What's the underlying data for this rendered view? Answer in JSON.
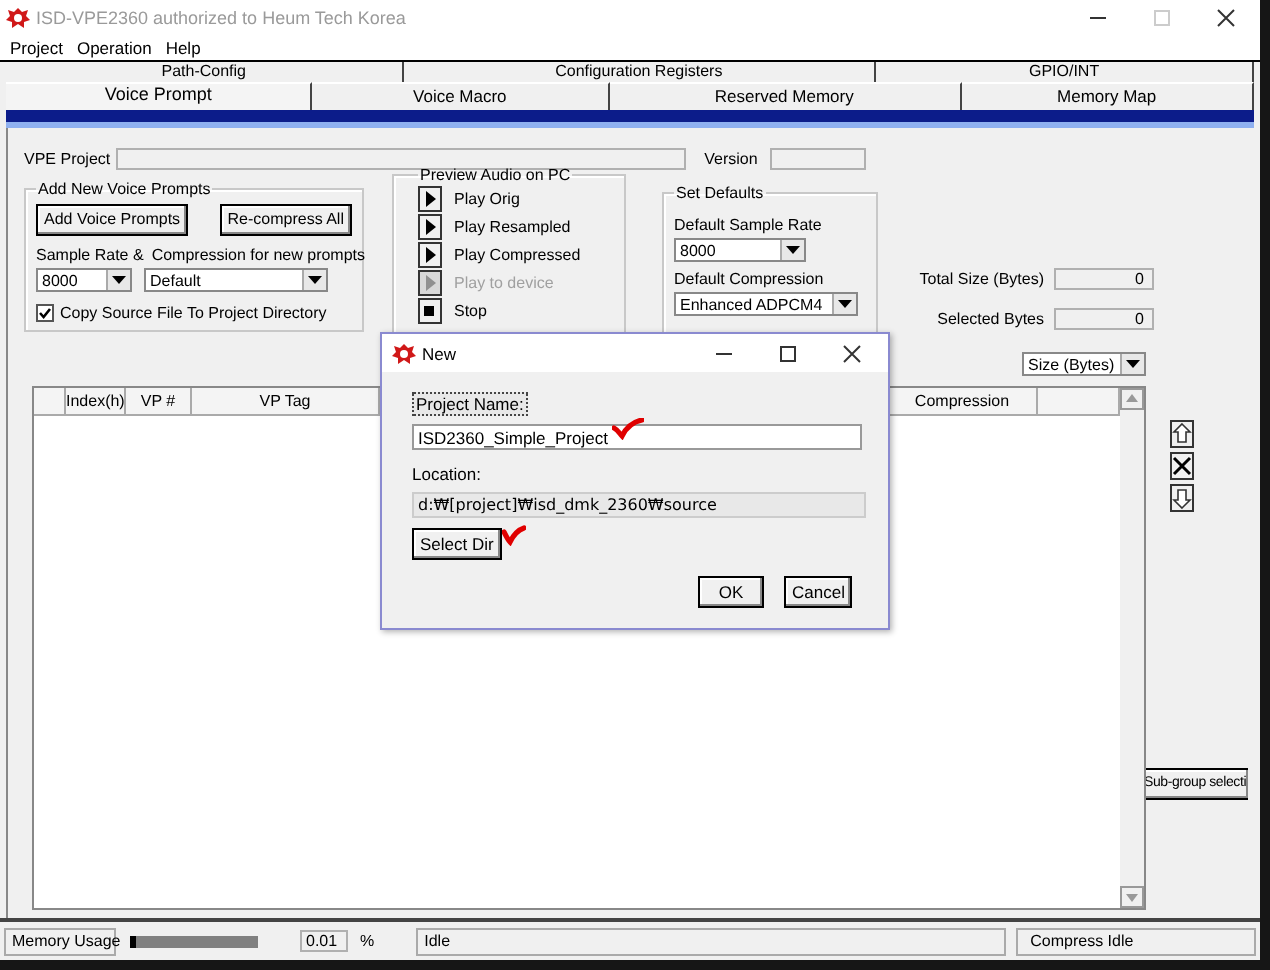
{
  "window": {
    "title": "ISD-VPE2360 authorized to Heum Tech Korea"
  },
  "menu": [
    "Project",
    "Operation",
    "Help"
  ],
  "back_tabs": [
    "Path-Config",
    "Configuration Registers",
    "GPIO/INT"
  ],
  "tabs": [
    {
      "label": "Voice Prompt",
      "selected": true
    },
    {
      "label": "Voice Macro",
      "selected": false
    },
    {
      "label": "Reserved Memory",
      "selected": false
    },
    {
      "label": "Memory Map",
      "selected": false
    }
  ],
  "project": {
    "label": "VPE Project",
    "version_label": "Version"
  },
  "add_group": {
    "title": "Add New Voice Prompts",
    "buttons": [
      "Add Voice Prompts",
      "Re-compress All"
    ],
    "sample_rate_label": "Sample Rate &",
    "sample_rate": "8000",
    "compression_label": "Compression for new prompts",
    "compression": "Default",
    "copy_source": {
      "label": "Copy Source File To Project Directory",
      "checked": true
    }
  },
  "preview": {
    "title": "Preview Audio on PC",
    "buttons": [
      {
        "label": "Play Orig",
        "kind": "play",
        "disabled": false
      },
      {
        "label": "Play Resampled",
        "kind": "play",
        "disabled": false
      },
      {
        "label": "Play Compressed",
        "kind": "play",
        "disabled": false
      },
      {
        "label": "Play to device",
        "kind": "play",
        "disabled": true
      },
      {
        "label": "Stop",
        "kind": "stop",
        "disabled": false
      }
    ]
  },
  "defaults": {
    "title": "Set Defaults",
    "sample_rate_label": "Default Sample Rate",
    "sample_rate": "8000",
    "compression_label": "Default Compression",
    "compression": "Enhanced ADPCM4"
  },
  "totals": [
    {
      "label": "Total Size (Bytes)",
      "value": "0"
    },
    {
      "label": "Selected Bytes",
      "value": "0"
    }
  ],
  "size_combo": "Size (Bytes)",
  "table": {
    "columns": [
      "Index(h)",
      "VP #",
      "VP Tag",
      "Compression"
    ]
  },
  "subgroup_button": "Sub-group selecti",
  "status_bar": {
    "memory_label": "Memory Usage",
    "memory": {
      "level": 0.04
    },
    "percent": "0.01",
    "percent_unit": "%",
    "status": "Idle",
    "compress_status": "Compress Idle"
  },
  "dialog": {
    "title": "New",
    "project_name_label": "Project Name:",
    "project_name": "ISD2360_Simple_Project",
    "location_label": "Location:",
    "location": "d:₩[project]₩isd_dmk_2360₩source",
    "select_dir": "Select Dir",
    "buttons": [
      "OK",
      "Cancel"
    ]
  }
}
